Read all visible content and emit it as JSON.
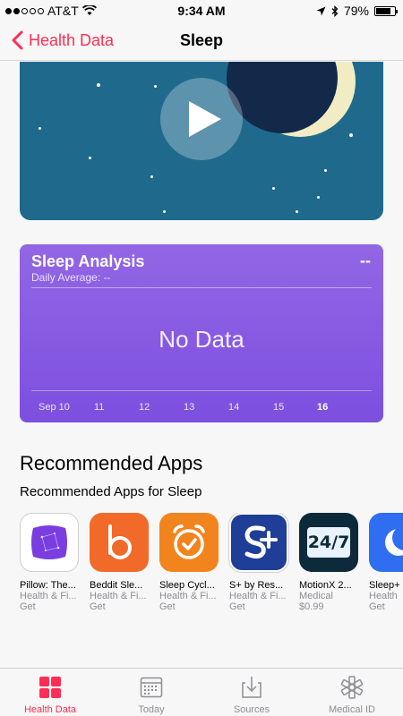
{
  "status_bar": {
    "carrier": "AT&T",
    "time": "9:34 AM",
    "battery": "79%",
    "battery_level": 0.79
  },
  "nav": {
    "back_label": "Health Data",
    "title": "Sleep"
  },
  "sleep_analysis": {
    "title": "Sleep Analysis",
    "value": "--",
    "subtitle": "Daily Average: --",
    "no_data": "No Data",
    "days": [
      "Sep 10",
      "11",
      "12",
      "13",
      "14",
      "15",
      "16"
    ]
  },
  "recommended": {
    "heading": "Recommended Apps",
    "subheading": "Recommended Apps for Sleep",
    "apps": [
      {
        "name": "Pillow: The...",
        "category": "Health & Fi...",
        "price": "Get",
        "color": "#7a3ee0"
      },
      {
        "name": "Beddit Sle...",
        "category": "Health & Fi...",
        "price": "Get",
        "color": "#f26a2a"
      },
      {
        "name": "Sleep Cycl...",
        "category": "Health & Fi...",
        "price": "Get",
        "color": "#f2841e"
      },
      {
        "name": "S+ by Res...",
        "category": "Health & Fi...",
        "price": "Get",
        "color": "#1f3e97"
      },
      {
        "name": "MotionX 2...",
        "category": "Medical",
        "price": "$0.99",
        "color": "#0c2a3a"
      },
      {
        "name": "Sleep+",
        "category": "Health",
        "price": "Get",
        "color": "#2f6ef0"
      }
    ]
  },
  "tabs": [
    {
      "label": "Health Data",
      "icon": "grid-icon",
      "active": true
    },
    {
      "label": "Today",
      "icon": "calendar-icon",
      "active": false
    },
    {
      "label": "Sources",
      "icon": "download-heart-icon",
      "active": false
    },
    {
      "label": "Medical ID",
      "icon": "medical-asterisk-icon",
      "active": false
    }
  ],
  "colors": {
    "accent": "#ff2d55",
    "video_bg": "#1f6a8c",
    "card_purple": "#8a5ae4"
  }
}
